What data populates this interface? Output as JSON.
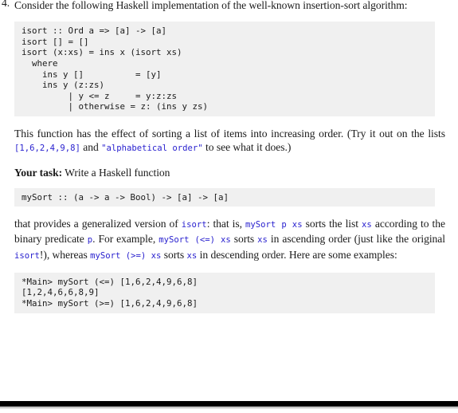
{
  "exercise": {
    "number": "4.",
    "intro": "Consider the following Haskell implementation of the well-known insertion-sort algorithm:",
    "isort_code": "isort :: Ord a => [a] -> [a]\nisort [] = []\nisort (x:xs) = ins x (isort xs)\n  where\n    ins y []          = [y]\n    ins y (z:zs)\n         | y <= z     = y:z:zs\n         | otherwise = z: (ins y zs)",
    "paragraph2": {
      "part1": "This function has the effect of sorting a list of items into increasing order. (Try it out on the lists ",
      "code1": "[1,6,2,4,9,8]",
      "part2": " and ",
      "code2": "\"alphabetical order\"",
      "part3": " to see what it does.)"
    },
    "task": {
      "label": "Your task:",
      "text": " Write a Haskell function"
    },
    "mysort_signature": "mySort :: (a -> a -> Bool) -> [a] -> [a]",
    "paragraph3": {
      "part1": "that provides a generalized version of ",
      "code1": "isort",
      "part2": ": that is, ",
      "code2": "mySort p xs",
      "part3": " sorts the list ",
      "code3": "xs",
      "part4": " according to the binary predicate ",
      "code4": "p",
      "part5": ". For example, ",
      "code5": "mySort (<=) xs",
      "part6": " sorts ",
      "code6": "xs",
      "part7": " in ascending order (just like the original ",
      "code7": "isort",
      "part8": "!), whereas ",
      "code8": "mySort (>=) xs",
      "part9": " sorts ",
      "code9": "xs",
      "part10": " in descending order. Here are some examples:"
    },
    "examples_code": "*Main> mySort (<=) [1,6,2,4,9,6,8]\n[1,2,4,6,6,8,9]\n*Main> mySort (>=) [1,6,2,4,9,6,8]"
  },
  "colors": {
    "code_background": "#f0f0f0",
    "inline_code_text": "#2a22cf",
    "body_text": "#1a1a1a",
    "rule": "#000000"
  }
}
